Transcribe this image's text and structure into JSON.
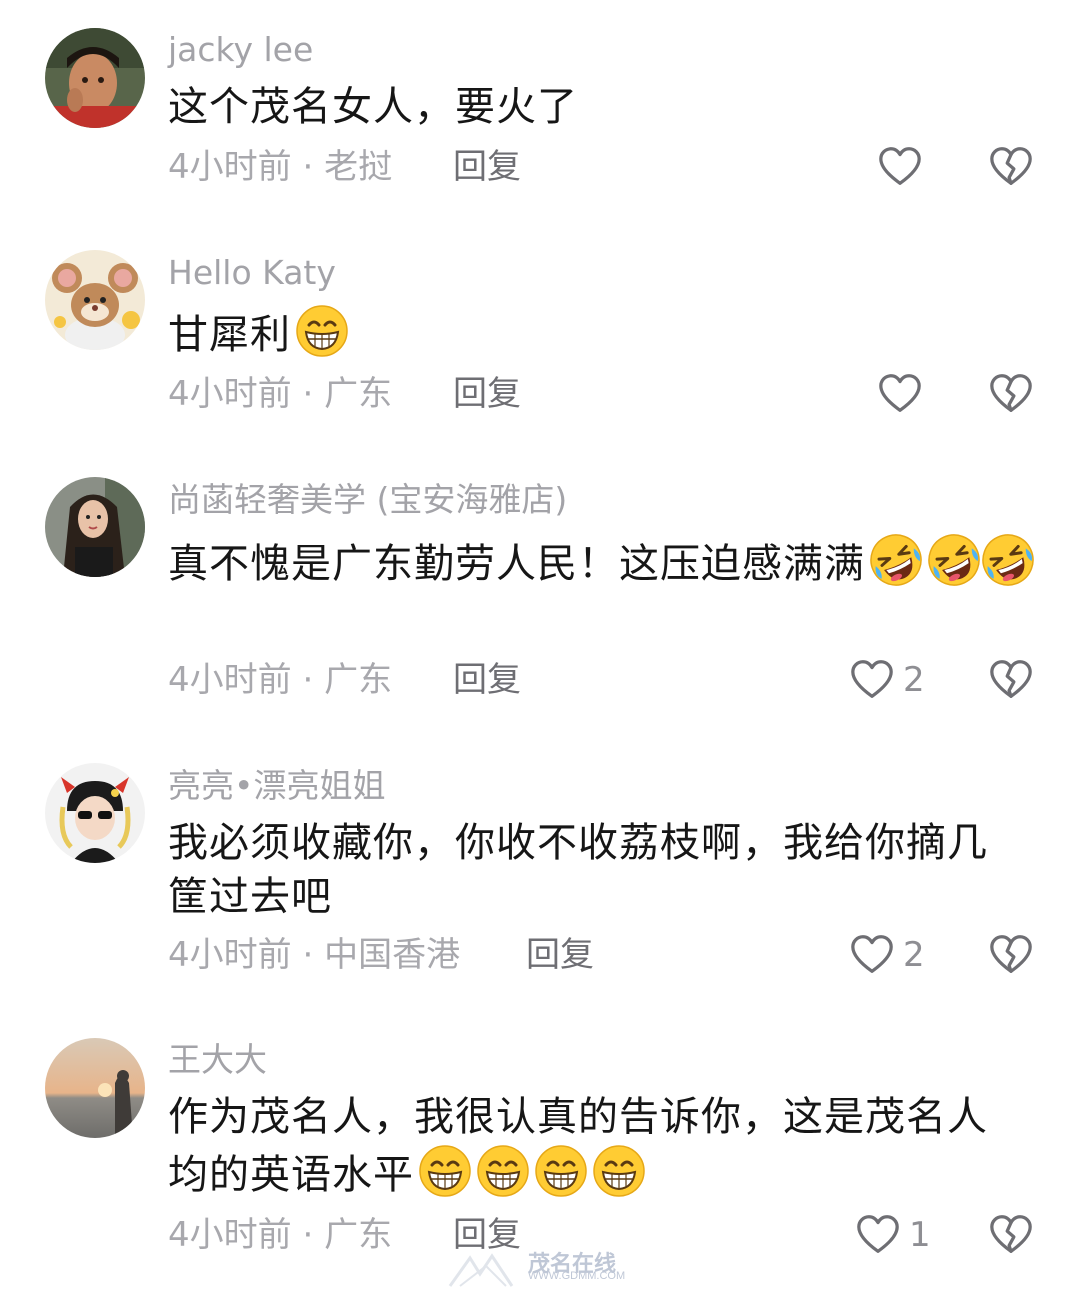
{
  "comments": [
    {
      "username": "jacky lee",
      "text": "这个茂名女人，要火了",
      "time": "4小时前",
      "location": "老挝",
      "reply_label": "回复",
      "likes": ""
    },
    {
      "username": "Hello Katy",
      "text": "甘犀利",
      "emoji": "grinning-teeth-emoji",
      "time": "4小时前",
      "location": "广东",
      "reply_label": "回复",
      "likes": ""
    },
    {
      "username": "尚菡轻奢美学 (宝安海雅店)",
      "text": "真不愧是广东勤劳人民！这压迫感满满",
      "emoji": "rolling-laughing-emoji",
      "time": "4小时前",
      "location": "广东",
      "reply_label": "回复",
      "likes": "2"
    },
    {
      "username": "亮亮•漂亮姐姐",
      "text_line1": "我必须收藏你，你收不收荔枝啊，我给你摘几",
      "text_line2": "筐过去吧",
      "time": "4小时前",
      "location": "中国香港",
      "reply_label": "回复",
      "likes": "2"
    },
    {
      "username": "王大大",
      "text_line1": "作为茂名人，我很认真的告诉你，这是茂名人",
      "text_line2": "均的英语水平",
      "emoji": "grinning-teeth-emoji",
      "time": "4小时前",
      "location": "广东",
      "reply_label": "回复",
      "likes": "1"
    }
  ],
  "meta_separator": "·",
  "watermark": {
    "text": "茂名在线",
    "url": "WWW.GDMM.COM"
  },
  "colors": {
    "username": "#a3a3a8",
    "text": "#161616",
    "meta": "#a8a8ad",
    "reply": "#6e6e73",
    "icon": "#6e6e73"
  }
}
